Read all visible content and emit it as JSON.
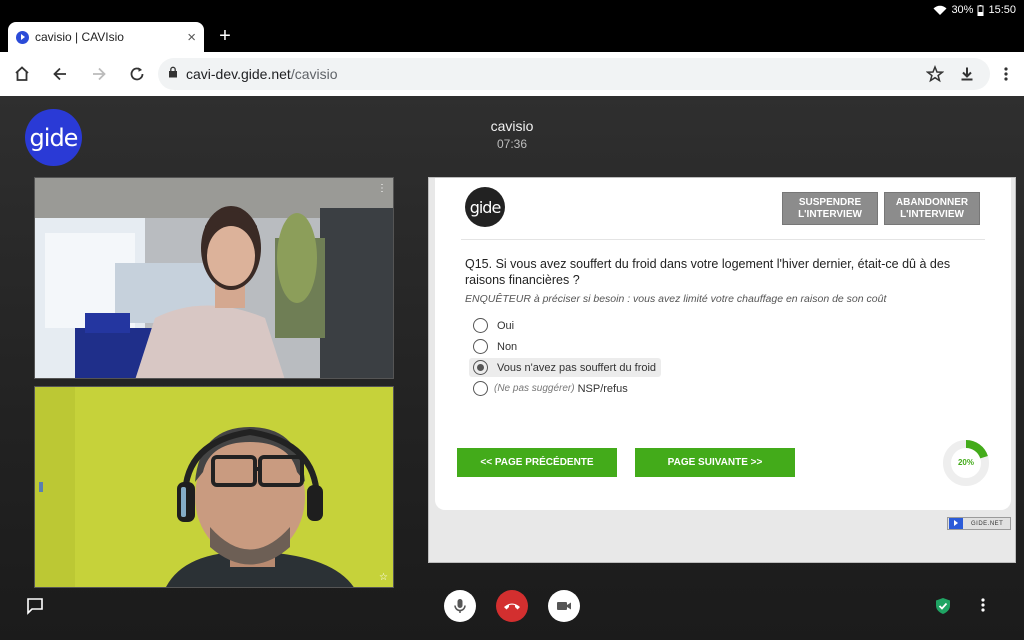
{
  "status_bar": {
    "battery": "30%",
    "time": "15:50"
  },
  "browser": {
    "tab_title": "cavisio | CAVIsio",
    "tab_close": "×",
    "new_tab": "+",
    "url_host": "cavi-dev.gide.net",
    "url_path": "/cavisio"
  },
  "app": {
    "logo_text": "gide",
    "room_name": "cavisio",
    "elapsed_time": "07:36",
    "video_tile_menu": "⋮",
    "video_tile_star": "☆"
  },
  "survey": {
    "logo_text": "gide",
    "suspend_label": "SUSPENDRE L'INTERVIEW",
    "abandon_label": "ABANDONNER L'INTERVIEW",
    "question": "Q15. Si vous avez souffert du froid dans votre logement l'hiver dernier, était-ce dû à des raisons financières ?",
    "hint": "ENQUÊTEUR à préciser si besoin : vous avez limité votre chauffage en raison de son coût",
    "options": [
      {
        "prefix": "",
        "label": "Oui",
        "selected": false
      },
      {
        "prefix": "",
        "label": "Non",
        "selected": false
      },
      {
        "prefix": "",
        "label": "Vous n'avez pas souffert du froid",
        "selected": true
      },
      {
        "prefix": "(Ne pas suggérer)",
        "label": "NSP/refus",
        "selected": false
      }
    ],
    "prev_label": "<< PAGE PRÉCÉDENTE",
    "next_label": "PAGE SUIVANTE >>",
    "progress_label": "20%",
    "progress_value": 0.2,
    "footer_badge": "GIDE.NET"
  },
  "controls": {
    "more": "⋮"
  },
  "colors": {
    "accent_green": "#43ab1a",
    "logo_blue": "#2a3ad6",
    "hangup_red": "#d32f2f",
    "button_grey": "#8c8c8c"
  }
}
